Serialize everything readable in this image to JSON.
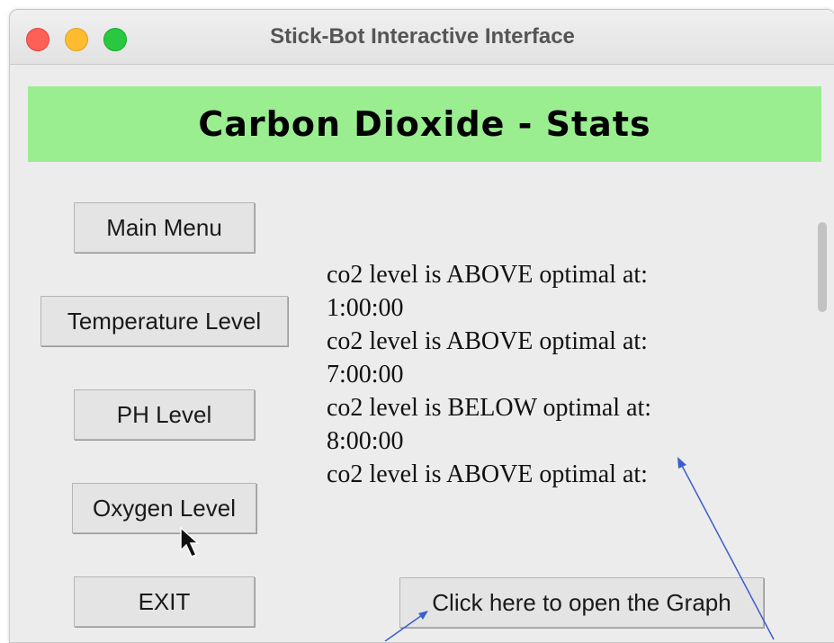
{
  "window": {
    "title": "Stick-Bot Interactive Interface",
    "traffic_lights": {
      "close": "#fe5f57",
      "minimize": "#febc2e",
      "zoom": "#28c840"
    }
  },
  "banner": {
    "title": "Carbon Dioxide - Stats",
    "color": "#9aee90"
  },
  "menu": {
    "main_menu": "Main Menu",
    "temperature": "Temperature Level",
    "ph": "PH Level",
    "oxygen": "Oxygen Level",
    "exit": "EXIT"
  },
  "log": {
    "lines": [
      "co2 level is ABOVE optimal at:",
      "1:00:00",
      "co2 level is ABOVE optimal at:",
      "7:00:00",
      "co2 level is BELOW optimal at:",
      "8:00:00",
      "co2 level is ABOVE optimal at:"
    ]
  },
  "graph_button": "Click here to open the Graph",
  "annotation_color": "#3a5fcd"
}
